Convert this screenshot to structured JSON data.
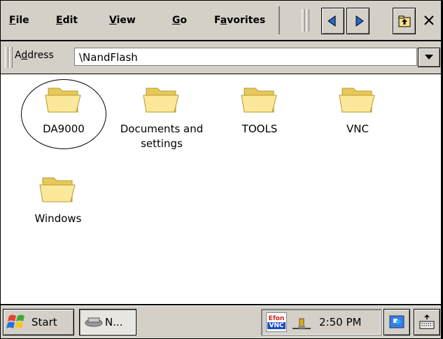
{
  "menubar": {
    "file": "File",
    "edit": "Edit",
    "view": "View",
    "go": "Go",
    "favorites": "Favorites"
  },
  "address": {
    "label": "Address",
    "value": "\\NandFlash"
  },
  "folders": [
    {
      "label": "DA9000"
    },
    {
      "label": "Documents and settings"
    },
    {
      "label": "TOOLS"
    },
    {
      "label": "VNC"
    },
    {
      "label": "Windows"
    }
  ],
  "taskbar": {
    "start_label": "Start",
    "task_label": "N...",
    "clock": "2:50 PM",
    "tray_icon_text_top": "Efon",
    "tray_icon_text_bottom": "VNC"
  },
  "colors": {
    "chrome": "#d4d0c8",
    "folder": "#f7e28a",
    "selection_accent": "#0000ff"
  },
  "icons": [
    "back-arrow-icon",
    "forward-arrow-icon",
    "up-folder-icon",
    "close-icon",
    "dropdown-arrow-icon",
    "folder-icon",
    "windows-flag-icon",
    "task-app-icon",
    "vnc-tray-icon",
    "network-tray-icon",
    "desktop-icon",
    "keyboard-icon"
  ]
}
